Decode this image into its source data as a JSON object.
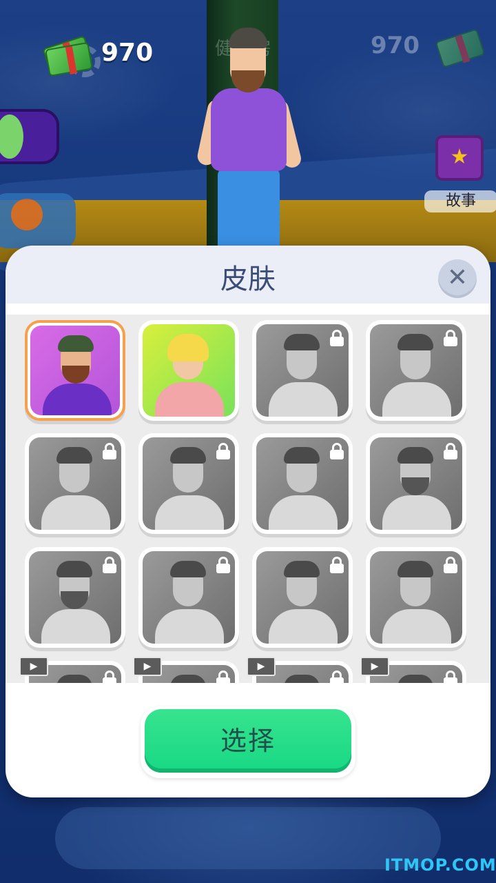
{
  "hud": {
    "coins": "970",
    "coins_dim": "970"
  },
  "scene": {
    "gym_sign": "健身房",
    "story_label": "故事"
  },
  "modal": {
    "title": "皮肤",
    "close_glyph": "✕",
    "select_label": "选择"
  },
  "skins": [
    {
      "id": "bearded-man",
      "state": "selected",
      "locked": false,
      "bg": "purple"
    },
    {
      "id": "blonde-woman",
      "state": "unlocked",
      "locked": false,
      "bg": "lime"
    },
    {
      "id": "hat-woman",
      "state": "locked",
      "locked": true
    },
    {
      "id": "curly-woman",
      "state": "locked",
      "locked": true
    },
    {
      "id": "headband-glasses",
      "state": "locked",
      "locked": true
    },
    {
      "id": "bun-glasses-woman",
      "state": "locked",
      "locked": true
    },
    {
      "id": "hoodie-man",
      "state": "locked",
      "locked": true
    },
    {
      "id": "headphones-man",
      "state": "locked",
      "locked": true
    },
    {
      "id": "bald-bearded-man",
      "state": "locked",
      "locked": true
    },
    {
      "id": "tie-man",
      "state": "locked",
      "locked": true
    },
    {
      "id": "glasses-man",
      "state": "locked",
      "locked": true
    },
    {
      "id": "collar-man",
      "state": "locked",
      "locked": true
    },
    {
      "id": "video-skin-1",
      "state": "video",
      "locked": true
    },
    {
      "id": "video-skin-2",
      "state": "video",
      "locked": true
    },
    {
      "id": "video-skin-3",
      "state": "video",
      "locked": true
    },
    {
      "id": "video-skin-4",
      "state": "video",
      "locked": true
    }
  ],
  "watermark": "ITMOP.COM",
  "colors": {
    "select_button": "#17d884",
    "selected_border": "#f5a04c",
    "modal_title": "#3a4c78",
    "watermark": "#2ec6f5"
  }
}
